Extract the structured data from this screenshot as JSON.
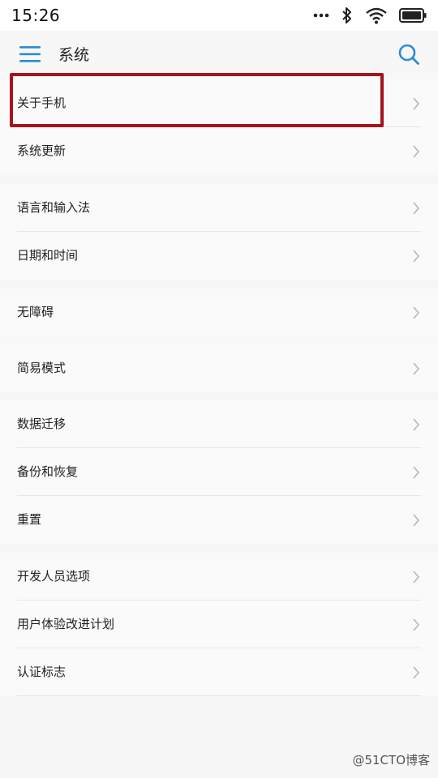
{
  "status_bar": {
    "time": "15:26",
    "icons": [
      "more-dots-icon",
      "bluetooth-icon",
      "wifi-icon",
      "battery-icon"
    ]
  },
  "app_bar": {
    "title": "系统",
    "icons": [
      "menu-icon",
      "search-icon"
    ]
  },
  "groups": [
    {
      "items": [
        {
          "label": "关于手机",
          "highlighted": true
        },
        {
          "label": "系统更新"
        }
      ]
    },
    {
      "items": [
        {
          "label": "语言和输入法"
        },
        {
          "label": "日期和时间"
        }
      ]
    },
    {
      "items": [
        {
          "label": "无障碍"
        }
      ]
    },
    {
      "items": [
        {
          "label": "简易模式"
        }
      ]
    },
    {
      "items": [
        {
          "label": "数据迁移"
        },
        {
          "label": "备份和恢复"
        },
        {
          "label": "重置"
        }
      ]
    },
    {
      "items": [
        {
          "label": "开发人员选项"
        },
        {
          "label": "用户体验改进计划"
        },
        {
          "label": "认证标志"
        }
      ]
    }
  ],
  "watermark": "@51CTO博客",
  "colors": {
    "accent": "#2a8bd6",
    "highlight": "#a3141e",
    "background": "#f7f7f7",
    "item_background": "#fafafa"
  }
}
